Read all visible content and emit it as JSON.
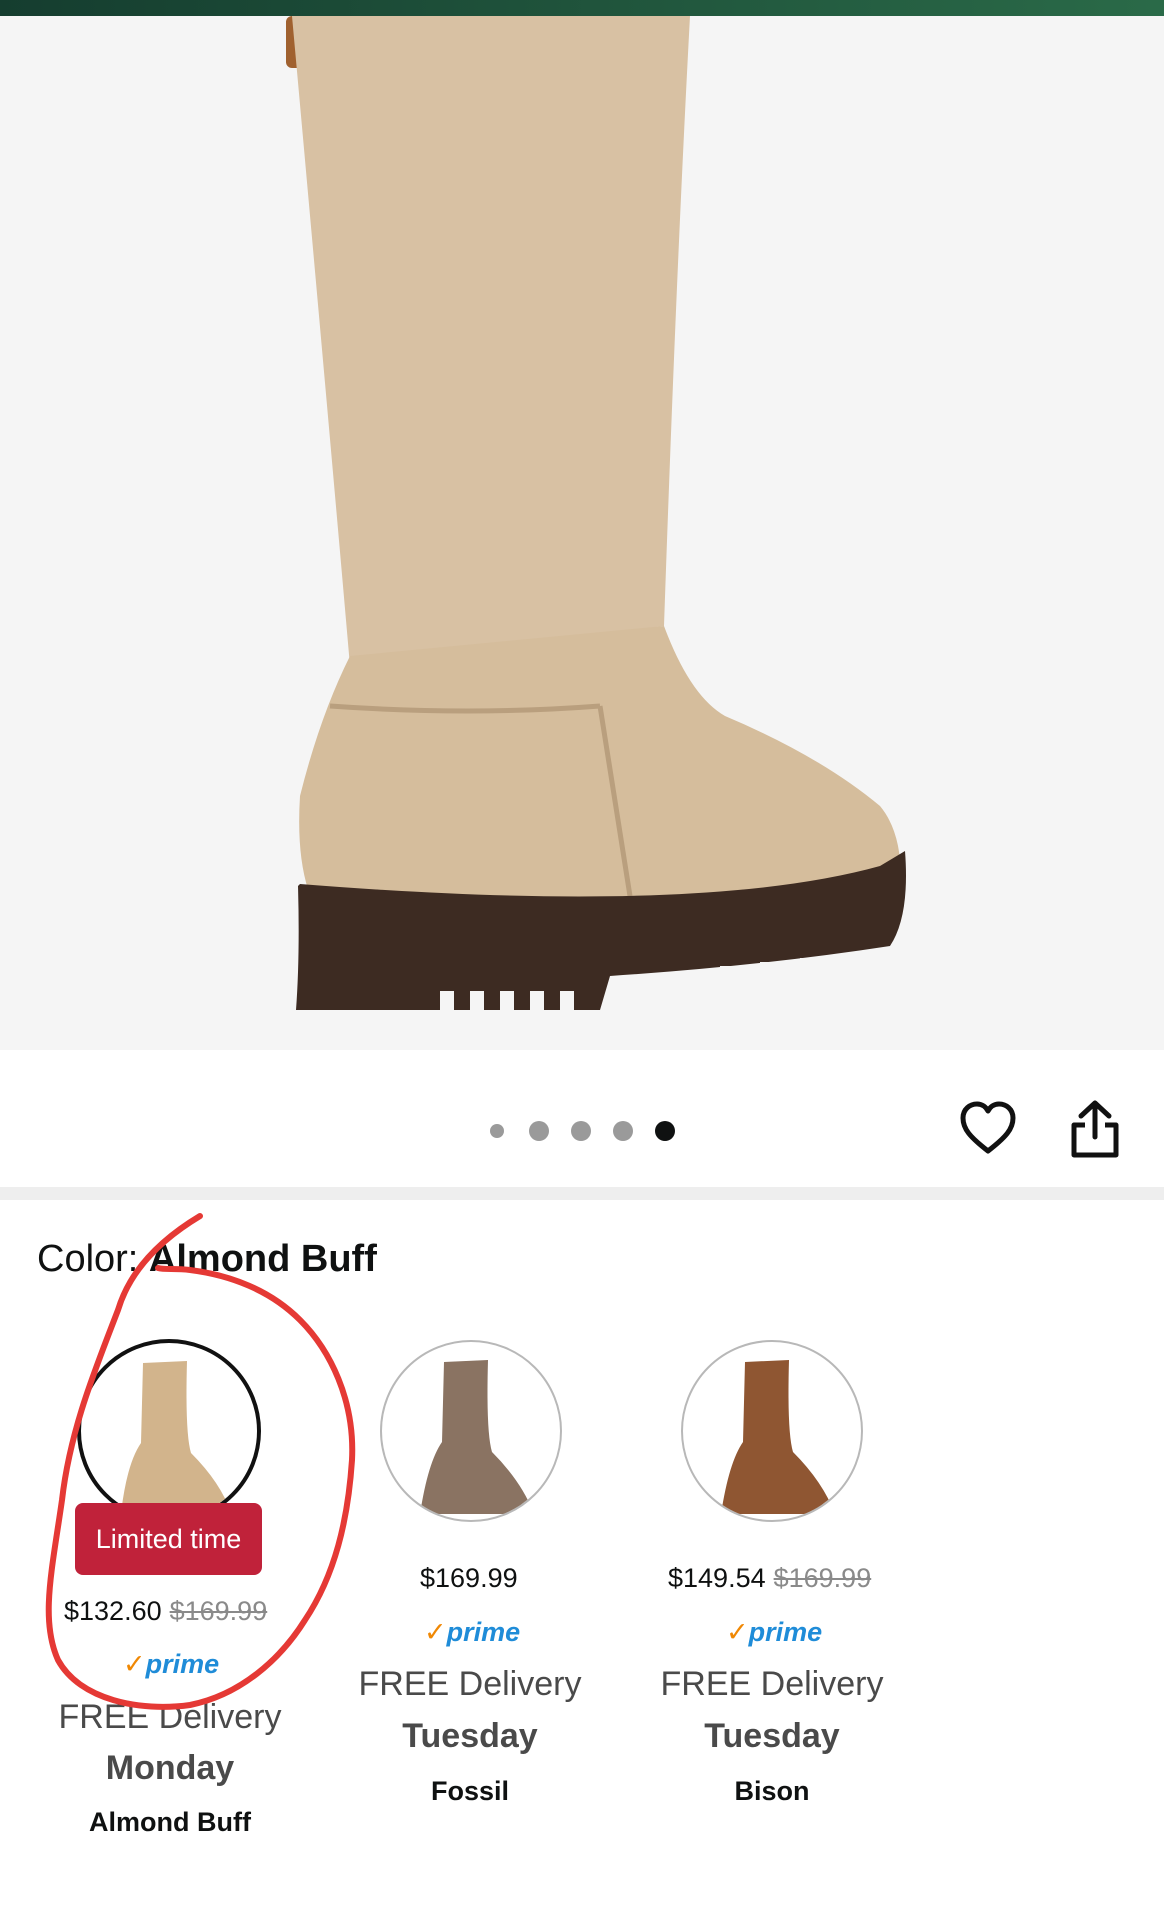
{
  "gallery": {
    "dots_count": 5,
    "active_index": 4
  },
  "actions": {
    "wishlist_icon": "heart-icon",
    "share_icon": "share-icon"
  },
  "color": {
    "label": "Color: ",
    "selected": "Almond Buff"
  },
  "swatches": [
    {
      "name": "Almond Buff",
      "badge": "Limited time",
      "price": "$132.60",
      "was_price": "$169.99",
      "prime": "prime",
      "delivery": "FREE Delivery",
      "day": "Monday",
      "color_hex": "#d2b48c"
    },
    {
      "name": "Fossil",
      "badge": "",
      "price": "$169.99",
      "was_price": "",
      "prime": "prime",
      "delivery": "FREE Delivery",
      "day": "Tuesday",
      "color_hex": "#8a7362"
    },
    {
      "name": "Bison",
      "badge": "",
      "price": "$149.54",
      "was_price": "$169.99",
      "prime": "prime",
      "delivery": "FREE Delivery",
      "day": "Tuesday",
      "color_hex": "#8f5632"
    }
  ],
  "colors": {
    "accent_red": "#c0223a",
    "prime_blue": "#1f8cd8",
    "prime_orange": "#f08804",
    "annotation_red": "#e53935"
  }
}
